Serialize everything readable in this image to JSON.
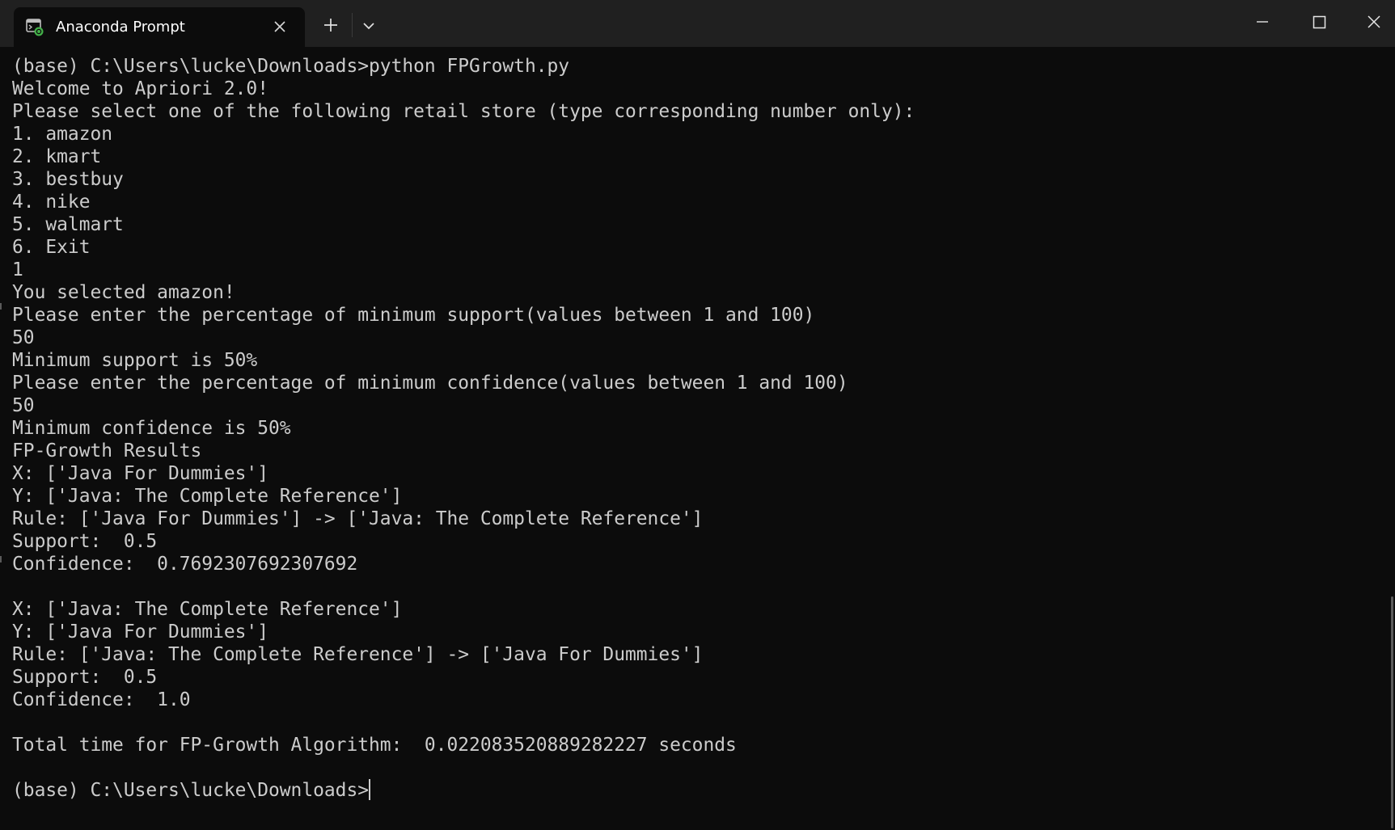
{
  "window": {
    "tab_title": "Anaconda Prompt"
  },
  "icons": {
    "tab": "terminal-app-icon",
    "close_tab": "close-icon",
    "new_tab": "plus-icon",
    "dropdown": "chevron-down-icon",
    "minimize": "minimize-icon",
    "maximize": "maximize-icon",
    "close_window": "close-icon"
  },
  "colors": {
    "background": "#0c0c0c",
    "titlebar": "#202020",
    "text": "#cccccc"
  },
  "console": {
    "lines": [
      "(base) C:\\Users\\lucke\\Downloads>python FPGrowth.py",
      "Welcome to Apriori 2.0!",
      "Please select one of the following retail store (type corresponding number only):",
      "1. amazon",
      "2. kmart",
      "3. bestbuy",
      "4. nike",
      "5. walmart",
      "6. Exit",
      "1",
      "You selected amazon!",
      "Please enter the percentage of minimum support(values between 1 and 100)",
      "50",
      "Minimum support is 50%",
      "Please enter the percentage of minimum confidence(values between 1 and 100)",
      "50",
      "Minimum confidence is 50%",
      "FP-Growth Results",
      "X: ['Java For Dummies']",
      "Y: ['Java: The Complete Reference']",
      "Rule: ['Java For Dummies'] -> ['Java: The Complete Reference']",
      "Support:  0.5",
      "Confidence:  0.7692307692307692",
      "",
      "X: ['Java: The Complete Reference']",
      "Y: ['Java For Dummies']",
      "Rule: ['Java: The Complete Reference'] -> ['Java For Dummies']",
      "Support:  0.5",
      "Confidence:  1.0",
      "",
      "Total time for FP-Growth Algorithm:  0.022083520889282227 seconds",
      "",
      "(base) C:\\Users\\lucke\\Downloads>"
    ]
  }
}
